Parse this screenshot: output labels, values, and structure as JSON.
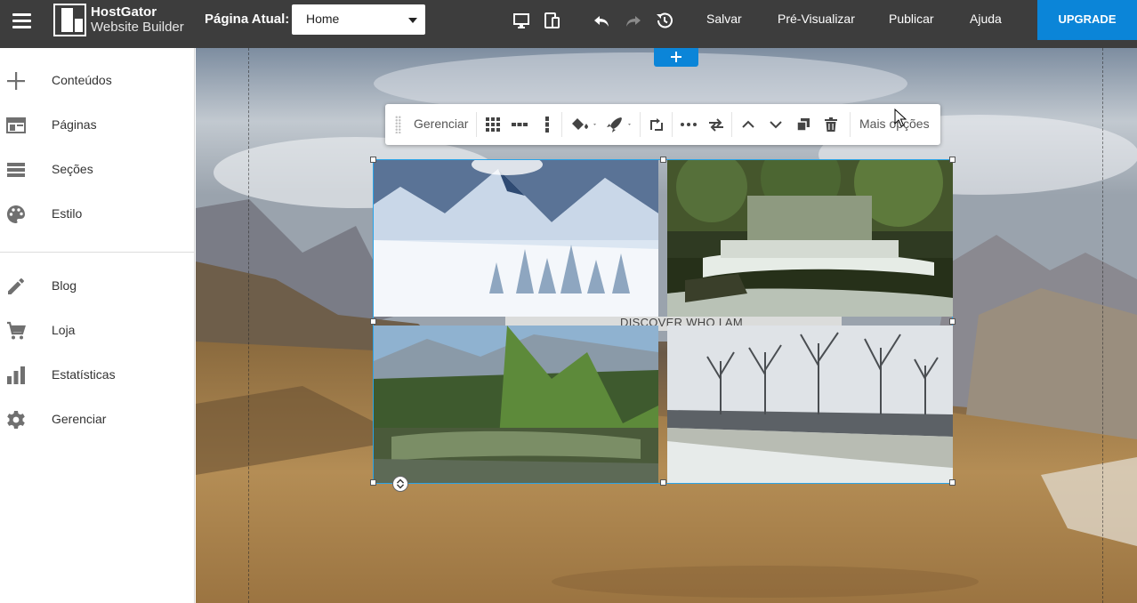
{
  "topbar": {
    "logo_line1": "HostGator",
    "logo_line2": "Website Builder",
    "page_label": "Página Atual:",
    "page_select_value": "Home",
    "save": "Salvar",
    "preview": "Pré-Visualizar",
    "publish": "Publicar",
    "help": "Ajuda",
    "upgrade": "UPGRADE"
  },
  "sidebar": {
    "items": [
      {
        "label": "Conteúdos",
        "icon": "plus-icon"
      },
      {
        "label": "Páginas",
        "icon": "pages-icon"
      },
      {
        "label": "Seções",
        "icon": "sections-icon"
      },
      {
        "label": "Estilo",
        "icon": "palette-icon"
      },
      {
        "label": "Blog",
        "icon": "pencil-icon"
      },
      {
        "label": "Loja",
        "icon": "cart-icon"
      },
      {
        "label": "Estatísticas",
        "icon": "bar-chart-icon"
      },
      {
        "label": "Gerenciar",
        "icon": "gear-icon"
      }
    ]
  },
  "element_toolbar": {
    "manage": "Gerenciar",
    "more_options": "Mais opções"
  },
  "canvas": {
    "hero_text": "DISCOVER WHO I AM"
  },
  "colors": {
    "topbar": "#3d3d3d",
    "accent": "#0b85d8",
    "selection": "#2aa4e8"
  }
}
